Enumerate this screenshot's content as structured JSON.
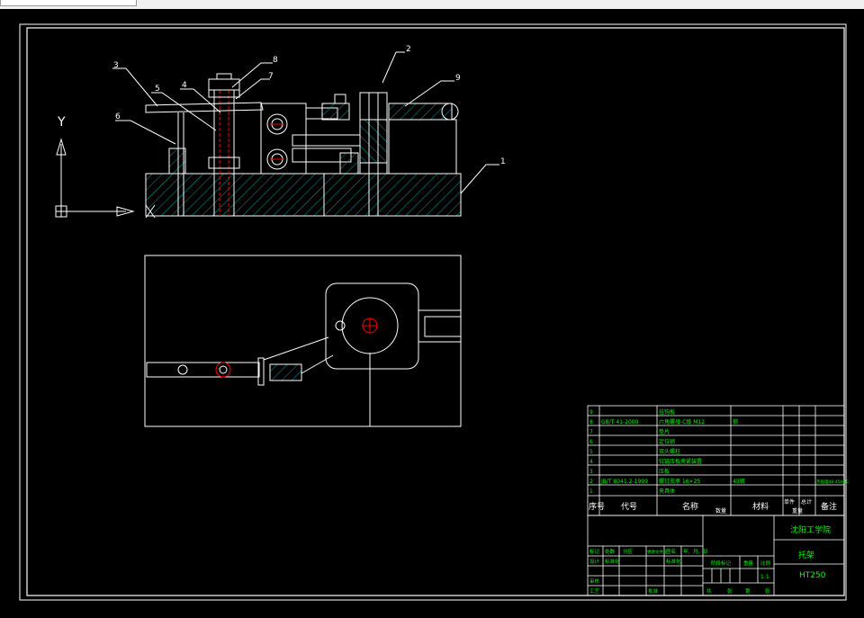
{
  "app": {
    "tab_label": ""
  },
  "colors": {
    "background": "#000000",
    "line": "#ffffff",
    "cyan": "#00a0a0",
    "red": "#ff0000",
    "green": "#00ff00",
    "yellow": "#ffff00"
  },
  "drawing": {
    "balloons": [
      "1",
      "2",
      "3",
      "4",
      "5",
      "6",
      "7",
      "8",
      "9"
    ],
    "axis_y": "Y",
    "axis_x": "X"
  },
  "bom": {
    "rows": [
      {
        "no": "9",
        "code": "",
        "name": "挂钩板",
        "qty": "",
        "material": "",
        "note": ""
      },
      {
        "no": "8",
        "code": "GB/T 41-2000",
        "name": "六角螺母-C级 M12",
        "qty": "",
        "material": "钢",
        "note": ""
      },
      {
        "no": "7",
        "code": "",
        "name": "垫片",
        "qty": "",
        "material": "",
        "note": ""
      },
      {
        "no": "6",
        "code": "",
        "name": "定位销",
        "qty": "",
        "material": "",
        "note": ""
      },
      {
        "no": "5",
        "code": "",
        "name": "双头螺柱",
        "qty": "",
        "material": "",
        "note": ""
      },
      {
        "no": "4",
        "code": "",
        "name": "铰链压板夹紧装置",
        "qty": "",
        "material": "",
        "note": ""
      },
      {
        "no": "3",
        "code": "",
        "name": "压板",
        "qty": "",
        "material": "",
        "note": ""
      },
      {
        "no": "2",
        "code": "JB/T 8041.2-1999",
        "name": "螺钉支承 16×25",
        "qty": "",
        "material": "45钢",
        "note": "热处理40-45HRC"
      },
      {
        "no": "1",
        "code": "",
        "name": "夹具体",
        "qty": "",
        "material": "",
        "note": ""
      }
    ],
    "header": {
      "no": "序号",
      "code": "代号",
      "name": "名称",
      "qty": "数量",
      "material": "材料",
      "single": "单件",
      "total": "总计",
      "weight": "重量",
      "note": "备注"
    }
  },
  "title_block": {
    "school": "沈阳工学院",
    "part_name": "托架",
    "material": "HT250",
    "scale_value": "1:1",
    "row_labels": [
      "标记",
      "处数",
      "分区",
      "更改文件号",
      "签名",
      "年、月、日"
    ],
    "design": "设计",
    "standardize": "标准化",
    "review": "审核",
    "process": "工艺",
    "approve": "批准",
    "stage": "阶段标记",
    "weight": "重量",
    "scale": "比例",
    "sheet_total": "共",
    "sheet_word": "张",
    "sheet_no": "第"
  }
}
